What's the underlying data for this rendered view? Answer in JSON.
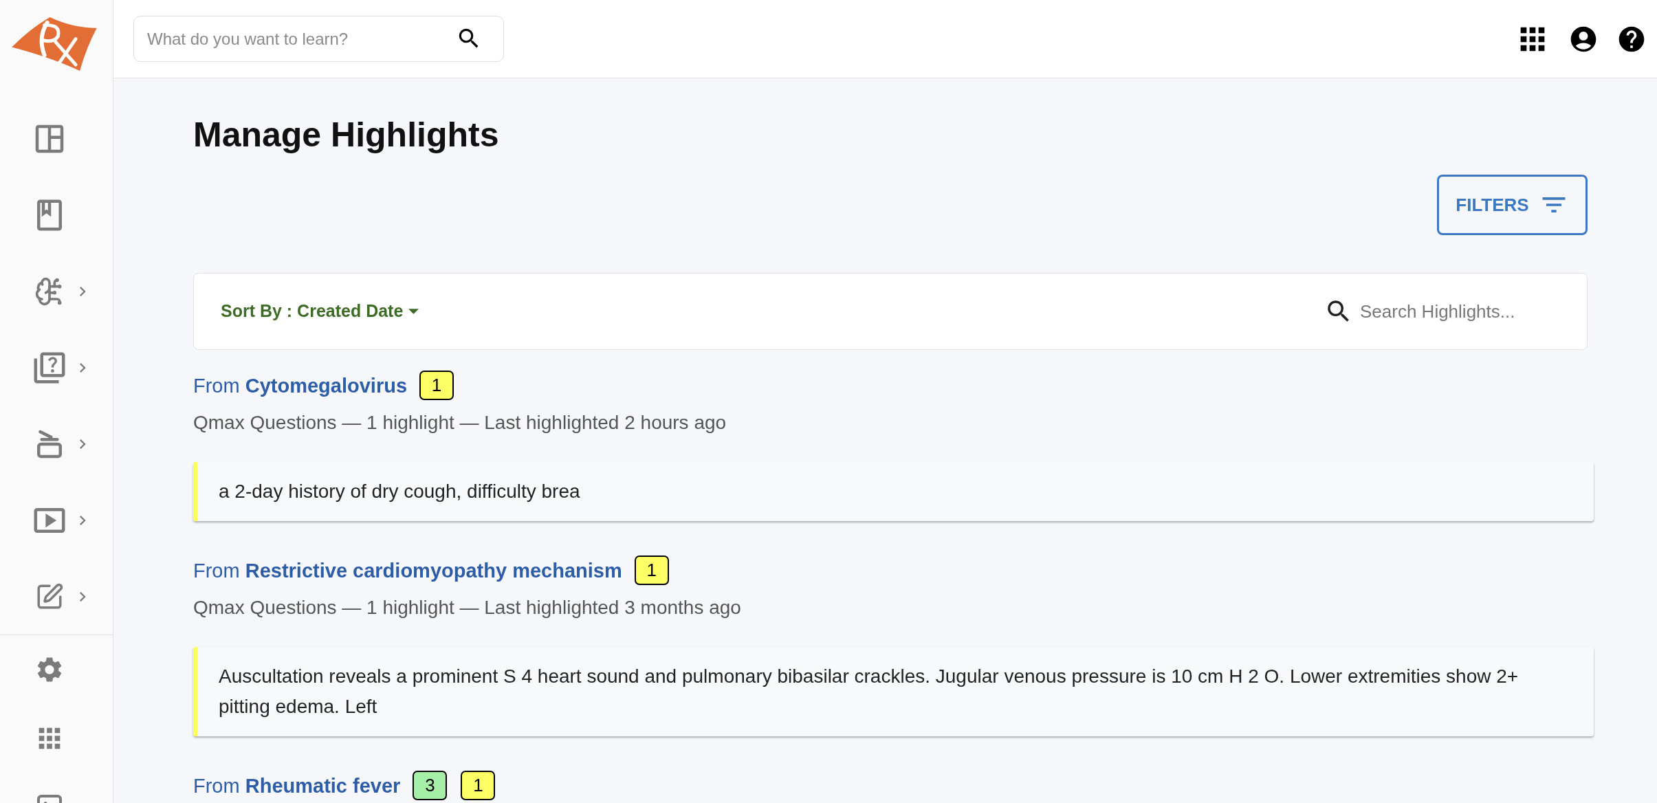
{
  "sidebar": {
    "items": [
      {
        "expandable": false
      },
      {
        "expandable": false
      },
      {
        "expandable": true
      },
      {
        "expandable": true
      },
      {
        "expandable": true
      },
      {
        "expandable": true
      },
      {
        "expandable": true
      }
    ]
  },
  "topbar": {
    "search": {
      "placeholder": "What do you want to learn?"
    }
  },
  "page": {
    "title": "Manage Highlights",
    "filters_button": {
      "label": "FILTERS"
    }
  },
  "sort_bar": {
    "sort_label": "Sort By : Created Date",
    "search": {
      "placeholder": "Search Highlights..."
    }
  },
  "groups": [
    {
      "title": "From **Cytomegalovirus**",
      "badges": [
        {
          "count": "1",
          "color": "#ffff66"
        }
      ],
      "meta": "Qmax Questions — 1 highlight — Last highlighted 2 hours ago",
      "highlights": [
        {
          "text": "a 2-day history of dry cough, difficulty brea",
          "color": "#ffff55"
        }
      ]
    },
    {
      "title": "From **Restrictive cardiomyopathy mechanism**",
      "badges": [
        {
          "count": "1",
          "color": "#ffff66"
        }
      ],
      "meta": "Qmax Questions — 1 highlight — Last highlighted 3 months ago",
      "highlights": [
        {
          "text": "Auscultation reveals a prominent S 4 heart sound and pulmonary bibasilar crackles. Jugular venous pressure is 10 cm H 2 O. Lower extremities show 2+ pitting edema. Left",
          "color": "#ffff55"
        }
      ]
    },
    {
      "title": "From **Rheumatic fever**",
      "badges": [
        {
          "count": "3",
          "color": "#a6efa6"
        },
        {
          "count": "1",
          "color": "#ffff66"
        }
      ]
    }
  ]
}
